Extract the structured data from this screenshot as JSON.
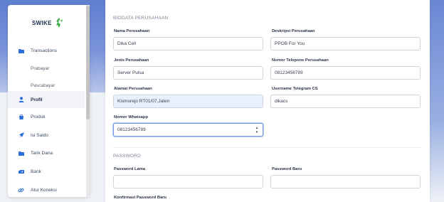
{
  "brand": {
    "name": "SWIKE"
  },
  "sidebar": {
    "items": [
      {
        "label": "Transactions",
        "icon": "folder-icon",
        "type": "main"
      },
      {
        "label": "Prabayar",
        "icon": "",
        "type": "sub"
      },
      {
        "label": "Pascabayar",
        "icon": "",
        "type": "sub"
      },
      {
        "label": "Profil",
        "icon": "user-icon",
        "type": "main",
        "active": true
      },
      {
        "label": "Produk",
        "icon": "bag-icon",
        "type": "main"
      },
      {
        "label": "Isi Saldo",
        "icon": "rocket-icon",
        "type": "main"
      },
      {
        "label": "Tarik Dana",
        "icon": "folder-icon",
        "type": "main"
      },
      {
        "label": "Bank",
        "icon": "bank-icon",
        "type": "main"
      },
      {
        "label": "Atur Koneksi",
        "icon": "link-icon",
        "type": "main"
      }
    ]
  },
  "biodata": {
    "title": "BIODATA PERUSAHAAN",
    "nama_label": "Nama Perusahaan",
    "nama_value": "Dika Cell",
    "deskripsi_label": "Deskripsi Perusahaan",
    "deskripsi_value": "PPOB For You",
    "jenis_label": "Jenis Perusahaan",
    "jenis_value": "Server Pulsa",
    "telepon_label": "Nomor Telepone Perusahaan",
    "telepon_value": "08123456789",
    "alamat_label": "Alamat Perusahaan",
    "alamat_value": "Kismorejo RT01/07,Jaten",
    "telegram_label": "Username Telegram CS",
    "telegram_value": "dikacs",
    "whatsapp_label": "Nomor Whatsapp",
    "whatsapp_value": "08123456789"
  },
  "password": {
    "title": "PASSWORD",
    "lama_label": "Password Lama",
    "baru_label": "Password Baru",
    "konfirmasi_label": "Konfirmasi Password Baru"
  },
  "colors": {
    "accent": "#6b86d4",
    "brand_green": "#3fae4a",
    "icon_blue": "#2d6fd6"
  }
}
